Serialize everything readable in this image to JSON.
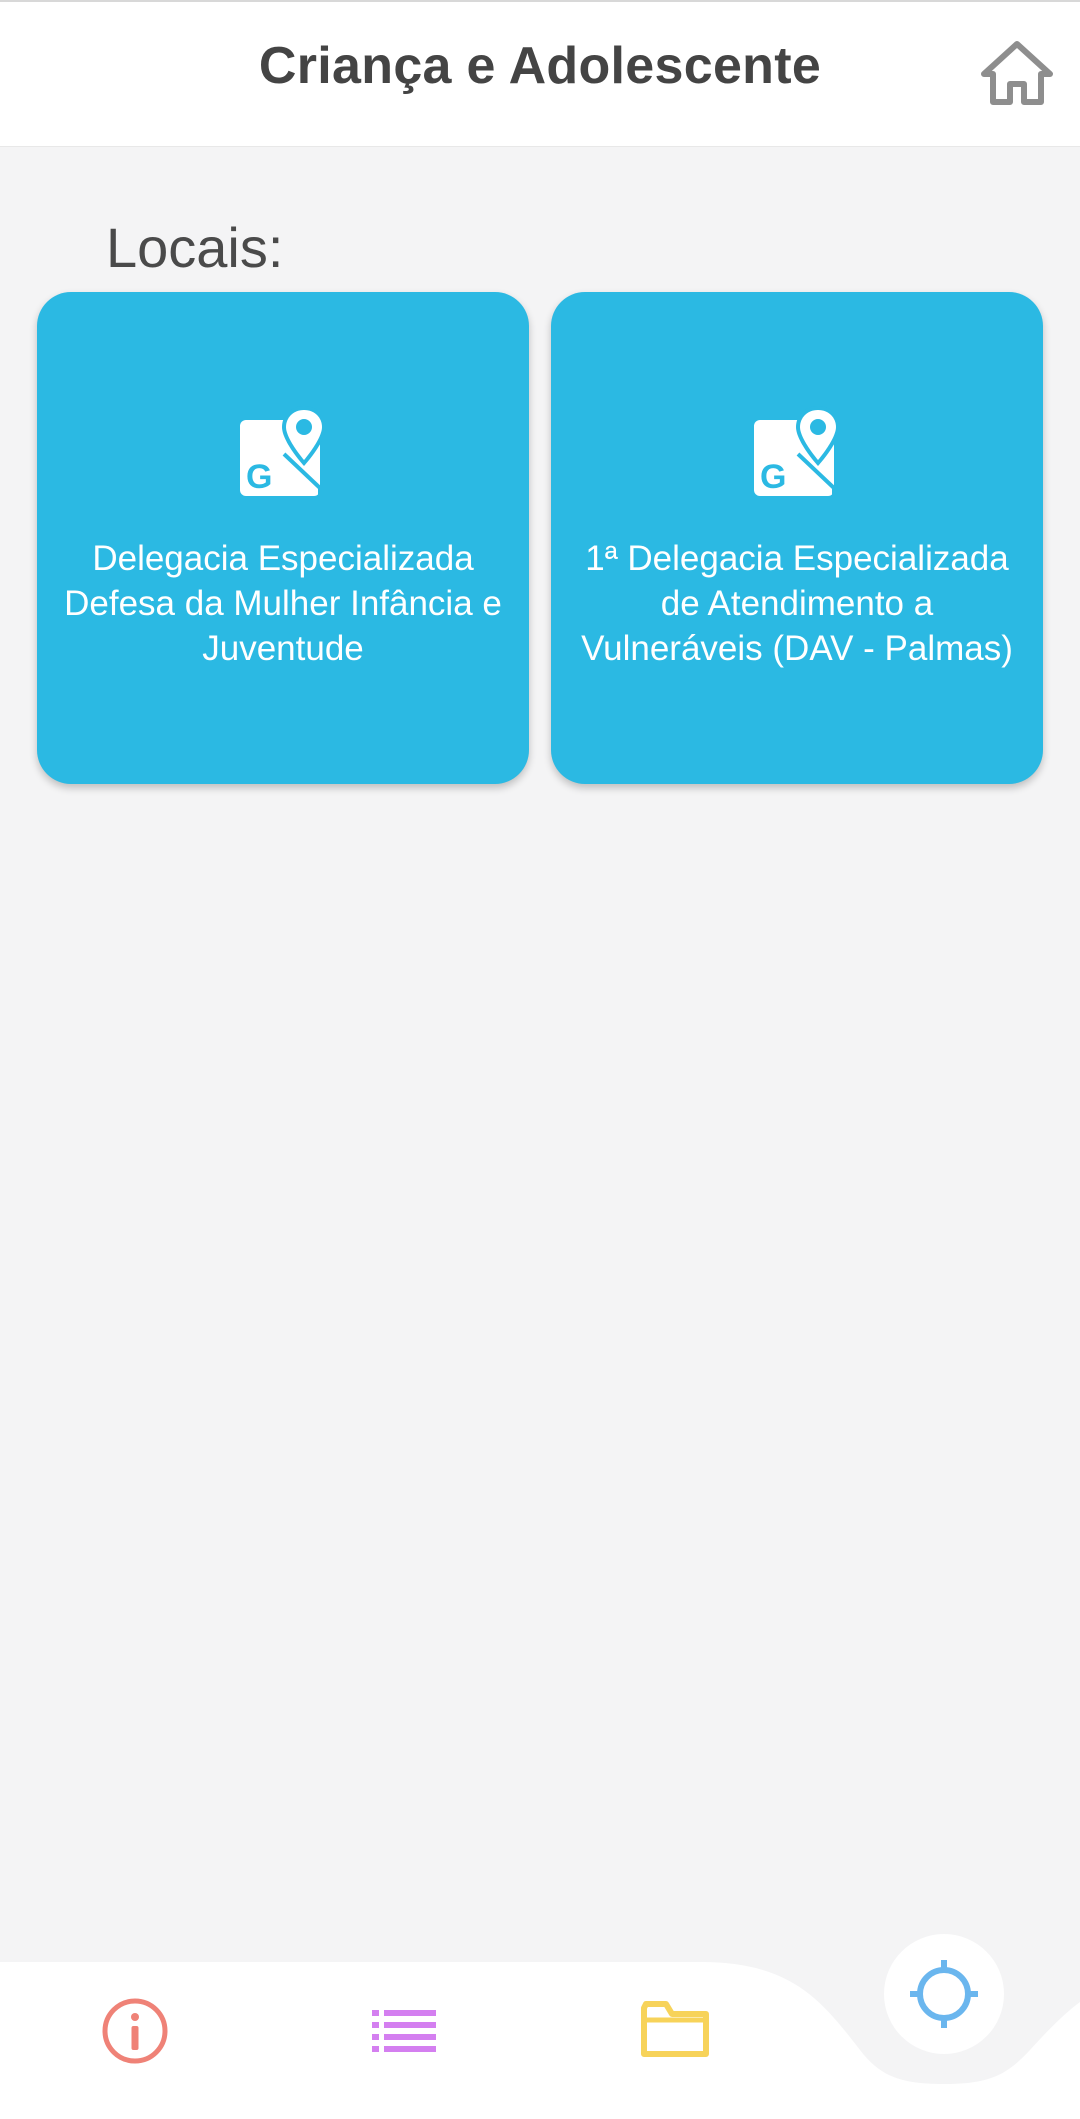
{
  "header": {
    "title": "Criança e Adolescente",
    "home_icon": "home-icon"
  },
  "main": {
    "section_label": "Locais:",
    "cards": [
      {
        "label": "Delegacia Especializada Defesa da Mulher Infância e Juventude",
        "icon": "google-maps-icon"
      },
      {
        "label": "1ª Delegacia Especializada de Atendimento a Vulneráveis (DAV - Palmas)",
        "icon": "google-maps-icon"
      }
    ]
  },
  "bottom_nav": {
    "items": [
      {
        "icon": "info-icon",
        "color": "#ef8277"
      },
      {
        "icon": "list-icon",
        "color": "#d47ff0"
      },
      {
        "icon": "folder-icon",
        "color": "#f7d35a"
      }
    ],
    "fab": {
      "icon": "crosshair-icon",
      "color": "#6ab6ee"
    }
  },
  "colors": {
    "card_bg": "#2bb9e3",
    "page_bg": "#f4f4f5",
    "header_text": "#444444"
  }
}
